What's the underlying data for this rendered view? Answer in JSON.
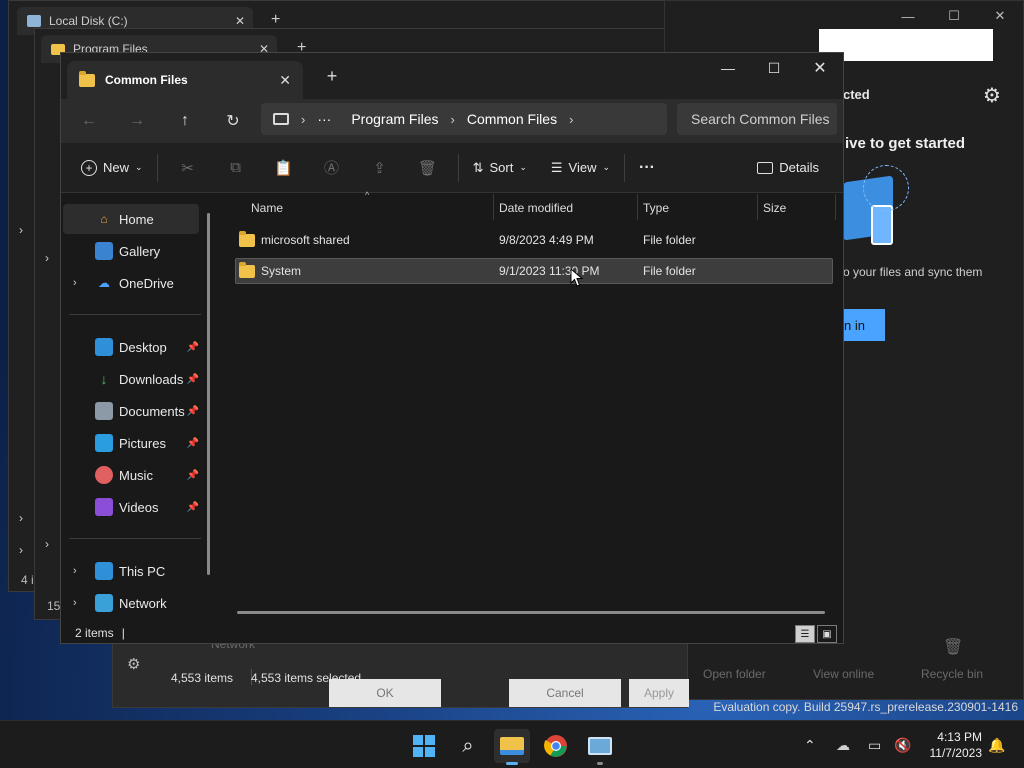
{
  "background": {
    "win1_tab": "Local Disk (C:)",
    "win2_tab": "Program Files",
    "left_status": "4 i",
    "left_status2": "15"
  },
  "onedrive": {
    "header_partial": "cted",
    "headline_partial": "ive to get started",
    "body_partial": "o your files and sync them",
    "button_partial": "n in",
    "links": [
      "Open folder",
      "View online",
      "Recycle bin"
    ]
  },
  "bg_dialog": {
    "sidebar_item": "Network",
    "items_count": "4,553 items",
    "items_selected": "4,553 items selected",
    "buttons": [
      "OK",
      "Cancel",
      "Apply"
    ]
  },
  "window": {
    "tab_title": "Common Files",
    "close_glyph": "✕",
    "new_tab_glyph": "+",
    "controls": [
      "—",
      "☐",
      "✕"
    ]
  },
  "address": {
    "ellipsis": "···",
    "crumbs": [
      "Program Files",
      "Common Files"
    ],
    "search_placeholder": "Search Common Files"
  },
  "toolbar": {
    "new_label": "New",
    "sort_label": "Sort",
    "view_label": "View",
    "more_label": "···",
    "details_label": "Details"
  },
  "sidebar": {
    "items": [
      {
        "label": "Home",
        "icon": "home-icon"
      },
      {
        "label": "Gallery",
        "icon": "gallery-icon"
      },
      {
        "label": "OneDrive",
        "icon": "cloud-icon"
      },
      {
        "label": "Desktop",
        "icon": "desktop-icon"
      },
      {
        "label": "Downloads",
        "icon": "download-icon"
      },
      {
        "label": "Documents",
        "icon": "document-icon"
      },
      {
        "label": "Pictures",
        "icon": "pictures-icon"
      },
      {
        "label": "Music",
        "icon": "music-icon"
      },
      {
        "label": "Videos",
        "icon": "video-icon"
      },
      {
        "label": "This PC",
        "icon": "pc-icon"
      },
      {
        "label": "Network",
        "icon": "network-icon"
      }
    ]
  },
  "columns": [
    "Name",
    "Date modified",
    "Type",
    "Size"
  ],
  "files": [
    {
      "name": "microsoft shared",
      "date": "9/8/2023 4:49 PM",
      "type": "File folder",
      "size": ""
    },
    {
      "name": "System",
      "date": "9/1/2023 11:30 PM",
      "type": "File folder",
      "size": ""
    }
  ],
  "status": {
    "items": "2 items",
    "cursor": "|"
  },
  "taskbar": {
    "time": "4:13 PM",
    "date": "11/7/2023"
  },
  "watermark": "Evaluation copy. Build 25947.rs_prerelease.230901-1416",
  "colors": {
    "accent": "#4aa3ff",
    "folder": "#f0c24a",
    "selection": "#3d3d3d"
  }
}
